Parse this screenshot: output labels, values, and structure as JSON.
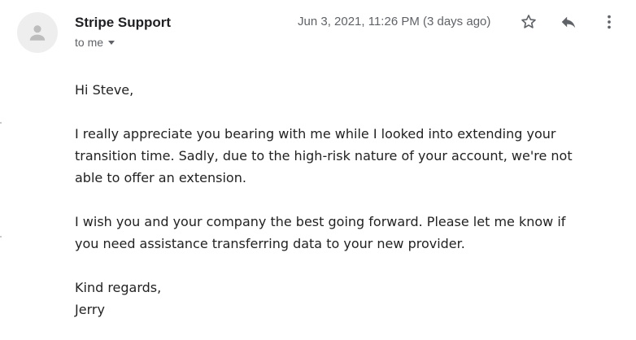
{
  "header": {
    "sender_name": "Stripe Support",
    "recipient_label": "to me",
    "date": "Jun 3, 2021, 11:26 PM (3 days ago)",
    "icons": {
      "avatar": "person-icon",
      "star": "star-icon",
      "reply": "reply-icon",
      "more": "more-vert-icon"
    }
  },
  "message": {
    "greeting": "Hi Steve,",
    "paragraph1_line1": "I really appreciate you bearing with me while I looked into extending your",
    "paragraph1_line2": "transition time. Sadly, due to the high-risk nature of your account, we're not",
    "paragraph1_line3": "able to offer an extension.",
    "paragraph2_line1": "I wish you and your company the best going forward. Please let me know if",
    "paragraph2_line2": "you need assistance transferring data to your new provider.",
    "closing": "Kind regards,",
    "signature": "Jerry"
  },
  "colors": {
    "text": "#222222",
    "secondary_text": "#5f6368",
    "avatar_bg": "#eeeeee",
    "avatar_fg": "#bdbdbd"
  }
}
